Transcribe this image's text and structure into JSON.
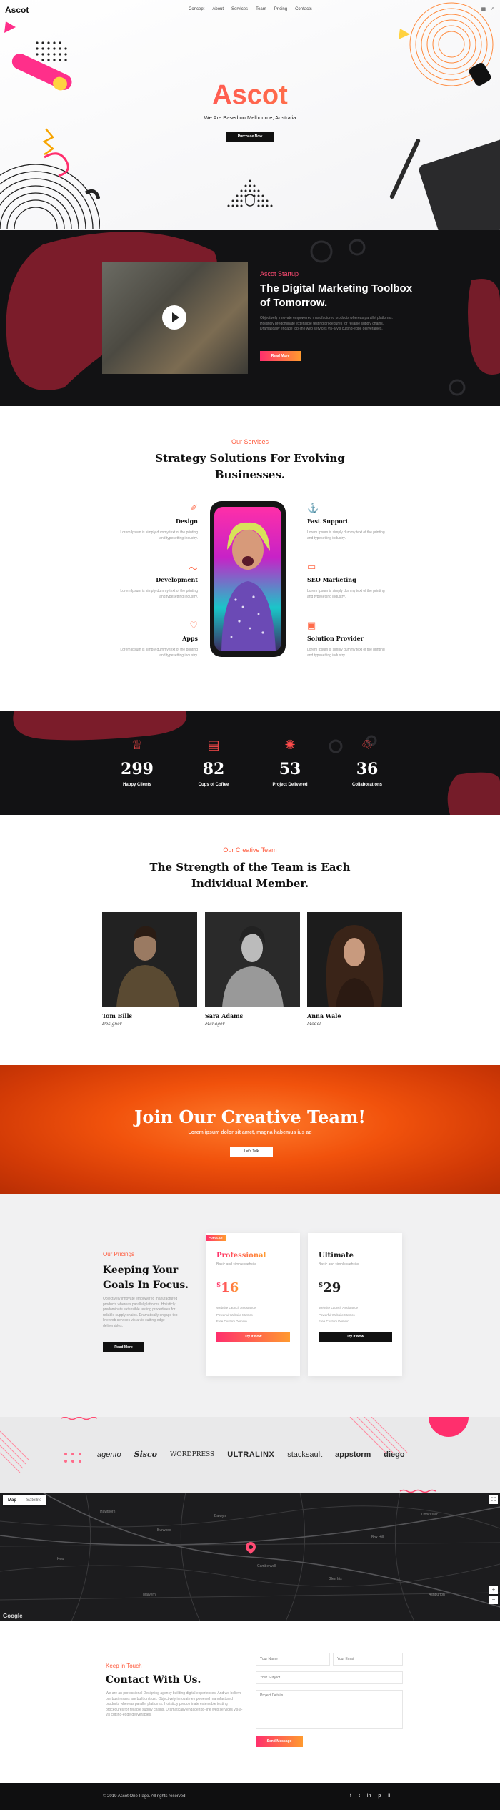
{
  "nav": {
    "logo": "Ascot",
    "items": [
      "Concept",
      "About",
      "Services",
      "Team",
      "Pricing",
      "Contacts"
    ],
    "grid_icon": "▦",
    "search_icon": "⌕"
  },
  "hero": {
    "title": "Ascot",
    "subtitle": "We Are Based on Melbourne, Australia",
    "button": "Purchase Now"
  },
  "video": {
    "kicker": "Ascot Startup",
    "title": "The Digital Marketing Toolbox of Tomorrow.",
    "text": "Objectively innovate empowered manufactured products whereas parallel platforms. Holisticly predominate extensible testing procedures for reliable supply chains. Dramatically engage top-line web services vis-a-vis cutting-edge deliverables.",
    "button": "Read More"
  },
  "services": {
    "kicker": "Our Services",
    "title": "Strategy Solutions For Evolving Businesses.",
    "items": [
      {
        "title": "Design",
        "text": "Lorem Ipsum is simply dummy text of the printing and typesetting industry.",
        "icon": "✐"
      },
      {
        "title": "Development",
        "text": "Lorem Ipsum is simply dummy text of the printing and typesetting industry.",
        "icon": "〜"
      },
      {
        "title": "Apps",
        "text": "Lorem Ipsum is simply dummy text of the printing and typesetting industry.",
        "icon": "♡"
      },
      {
        "title": "Fast Support",
        "text": "Lorem Ipsum is simply dummy text of the printing and typesetting industry.",
        "icon": "⚓"
      },
      {
        "title": "SEO Marketing",
        "text": "Lorem Ipsum is simply dummy text of the printing and typesetting industry.",
        "icon": "▭"
      },
      {
        "title": "Solution Provider",
        "text": "Lorem Ipsum is simply dummy text of the printing and typesetting industry.",
        "icon": "▣"
      }
    ]
  },
  "stats": [
    {
      "value": "299",
      "label": "Happy Clients",
      "icon": "♕"
    },
    {
      "value": "82",
      "label": "Cups of Coffee",
      "icon": "▤"
    },
    {
      "value": "53",
      "label": "Project Delivered",
      "icon": "✺"
    },
    {
      "value": "36",
      "label": "Collaborations",
      "icon": "♲"
    }
  ],
  "team": {
    "kicker": "Our Creative Team",
    "title": "The Strength of the Team is Each Individual Member.",
    "members": [
      {
        "name": "Tom Bills",
        "role": "Designer"
      },
      {
        "name": "Sara Adams",
        "role": "Manager"
      },
      {
        "name": "Anna Wale",
        "role": "Model"
      }
    ]
  },
  "cta": {
    "title": "Join Our Creative Team!",
    "subtitle": "Lorem ipsum dolor sit amet, magna habemus ius ad",
    "button": "Let's Talk"
  },
  "pricing": {
    "kicker": "Our Pricings",
    "title": "Keeping Your Goals In Focus.",
    "text": "Objectively innovate empowered manufactured products whereas parallel platforms. Holisticly predominate extensible testing procedures for reliable supply chains. Dramatically engage top-line web services vis-a-vis cutting-edge deliverables.",
    "button": "Read More",
    "plans": [
      {
        "badge": "POPULAR",
        "name": "Professional",
        "sub": "Basic and simple website.",
        "currency": "$",
        "price": "16",
        "features": [
          "Website Launch Assistance",
          "Powerful Website Metrics",
          "Free Custom Domain"
        ],
        "button": "Try It Now"
      },
      {
        "badge": "",
        "name": "Ultimate",
        "sub": "Basic and simple website.",
        "currency": "$",
        "price": "29",
        "features": [
          "Website Launch Assistance",
          "Powerful Website Metrics",
          "Free Custom Domain"
        ],
        "button": "Try It Now"
      }
    ]
  },
  "clients": [
    "agento",
    "Sisco",
    "WORDPRESS",
    "ULTRALINX",
    "stacksault",
    "appstorm",
    "diego"
  ],
  "map": {
    "tab_map": "Map",
    "tab_satellite": "Satellite",
    "google": "Google",
    "fullscreen": "⛶",
    "zoom_in": "+",
    "zoom_out": "−",
    "labels": [
      "Hawthorn",
      "Burwood",
      "Balwyn",
      "Camberwell",
      "Glen Iris",
      "Box Hill",
      "Doncaster",
      "Kew",
      "Malvern",
      "Ashburton"
    ]
  },
  "contact": {
    "kicker": "Keep in Touch",
    "title": "Contact With Us.",
    "text": "We are an professional Designing agency building digital experiences. And we believe our businesses are built on trust. Objectively innovate empowered manufactured products whereas parallel platforms. Holisticly predominate extensible testing procedures for reliable supply chains. Dramatically engage top-line web services vis-a-vis cutting-edge deliverables.",
    "name_placeholder": "Your Name",
    "email_placeholder": "Your Email",
    "subject_placeholder": "Your Subject",
    "details_placeholder": "Project Details",
    "button": "Send Message"
  },
  "footer": {
    "copyright": "© 2019 Ascot One Page. All rights reserved",
    "social": [
      "f",
      "t",
      "in",
      "p",
      "li"
    ]
  }
}
